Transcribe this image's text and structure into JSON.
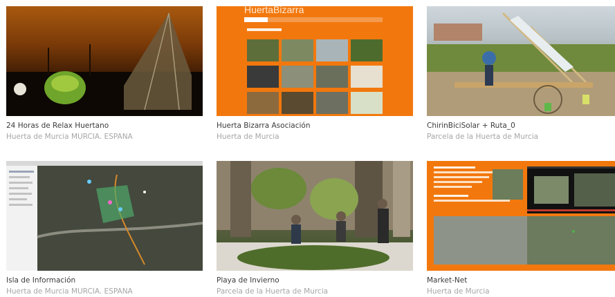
{
  "cards": [
    {
      "title": "24 Horas de Relax Huertano",
      "subtitle": "Huerta de Murcia MURCIA. ESPAÑA"
    },
    {
      "title": "Huerta Bizarra Asociación",
      "subtitle": "Huerta de Murcia",
      "thumb_heading": "HuertaBizarra"
    },
    {
      "title": "ChirinBiciSolar + Ruta_0",
      "subtitle": "Parcela de la Huerta de Murcia"
    },
    {
      "title": "Isla de Información",
      "subtitle": "Huerta de Murcia MURCIA. ESPAÑA"
    },
    {
      "title": "Playa de Invierno",
      "subtitle": "Parcela de la Huerta de Murcia"
    },
    {
      "title": "Market-Net",
      "subtitle": "Huerta de Murcia"
    }
  ],
  "colors": {
    "accent": "#f2780e",
    "title": "#3a3a3a",
    "subtitle": "#a6a6a6"
  }
}
